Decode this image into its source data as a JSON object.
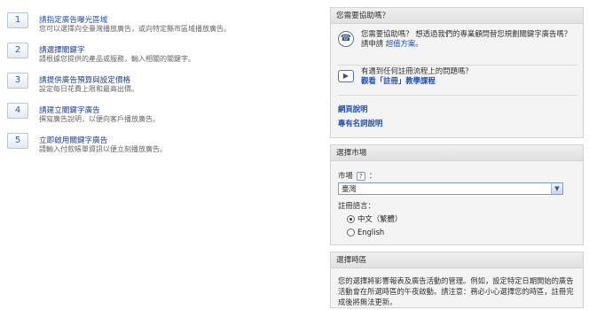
{
  "steps": [
    {
      "number": "1",
      "title": "請指定廣告曝光區域",
      "desc": "您可以選擇向全臺灣播放廣告，或向特定縣市區域播放廣告。"
    },
    {
      "number": "2",
      "title": "請選擇關鍵字",
      "desc": "請根據您提供的產品或服務，輸入相關的關鍵字。"
    },
    {
      "number": "3",
      "title": "請提供廣告預算與設定價格",
      "desc": "設定每日花費上限和最高出價。"
    },
    {
      "number": "4",
      "title": "請建立關鍵字廣告",
      "desc": "撰寫廣告說明，以便向客戶播放廣告。"
    },
    {
      "number": "5",
      "title": "立即啟用關鍵字廣告",
      "desc": "請輸入付款帳單資訊以便立刻播放廣告。"
    }
  ],
  "help": {
    "title": "您需要協助嗎？",
    "row1_text": "您需要協助嗎？ 想透過我們的專業顧問替您規劃關鍵字廣告嗎？請申請",
    "row1_link": "超值方案",
    "row1_end": "。",
    "row2_text": "有遇到任何註冊流程上的問題嗎？",
    "row2_link": "觀看「註冊」教學課程",
    "link_help": "網頁說明",
    "link_glossary": "專有名詞說明"
  },
  "region": {
    "title": "選擇市場",
    "market_label": "市場",
    "market_suffix": "：",
    "market_value": "臺灣",
    "lang_label": "註冊語言：",
    "lang_option1": "中文（繁體）",
    "lang_option2": "English"
  },
  "timezone": {
    "title": "選擇時區",
    "text": "您的選擇將影響報表及廣告活動的管理。例如，設定特定日期開始的廣告活動會在所選時區的午夜啟動。請注意：務必小心選擇您的時區，註冊完成後將無法更新。"
  },
  "colors": {
    "link": "#1f4fb8",
    "panel_bg": "#f4f4f4",
    "step_num": "#3d5f97"
  }
}
